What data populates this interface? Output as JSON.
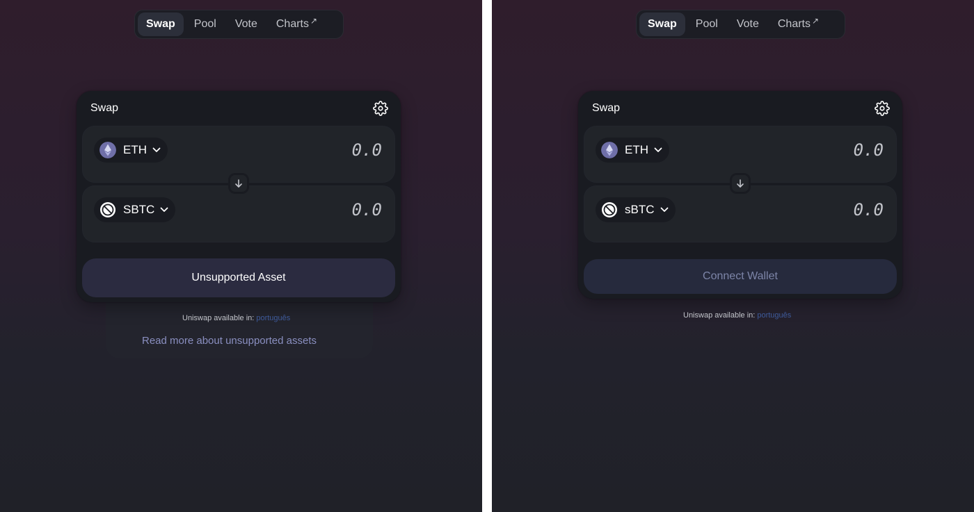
{
  "left": {
    "nav": [
      "Swap",
      "Pool",
      "Vote",
      "Charts"
    ],
    "nav_ext_arrow": "↗",
    "card_title": "Swap",
    "input_token": "ETH",
    "input_amount": "0.0",
    "output_token": "SBTC",
    "output_amount": "0.0",
    "action_label": "Unsupported Asset",
    "available_text": "Uniswap available in:",
    "available_lang": "português",
    "read_more": "Read more about unsupported assets"
  },
  "right": {
    "nav": [
      "Swap",
      "Pool",
      "Vote",
      "Charts"
    ],
    "nav_ext_arrow": "↗",
    "card_title": "Swap",
    "input_token": "ETH",
    "input_amount": "0.0",
    "output_token": "sBTC",
    "output_amount": "0.0",
    "action_label": "Connect Wallet",
    "available_text": "Uniswap available in:",
    "available_lang": "português"
  },
  "icons": {
    "gear": "gear-icon",
    "eth": "ethereum-icon",
    "sbtc": "sbtc-token-icon",
    "chevron": "chevron-down-icon",
    "arrow_down": "arrow-down-icon"
  },
  "colors": {
    "background_top": "#2f1d2c",
    "background_bottom": "#202128",
    "card": "#191b21",
    "input_box": "#212429",
    "unsupported_button": "#2b2b40",
    "connect_button": "#262a3d",
    "connect_text": "#7d85a8",
    "link": "#8a8fc0"
  }
}
